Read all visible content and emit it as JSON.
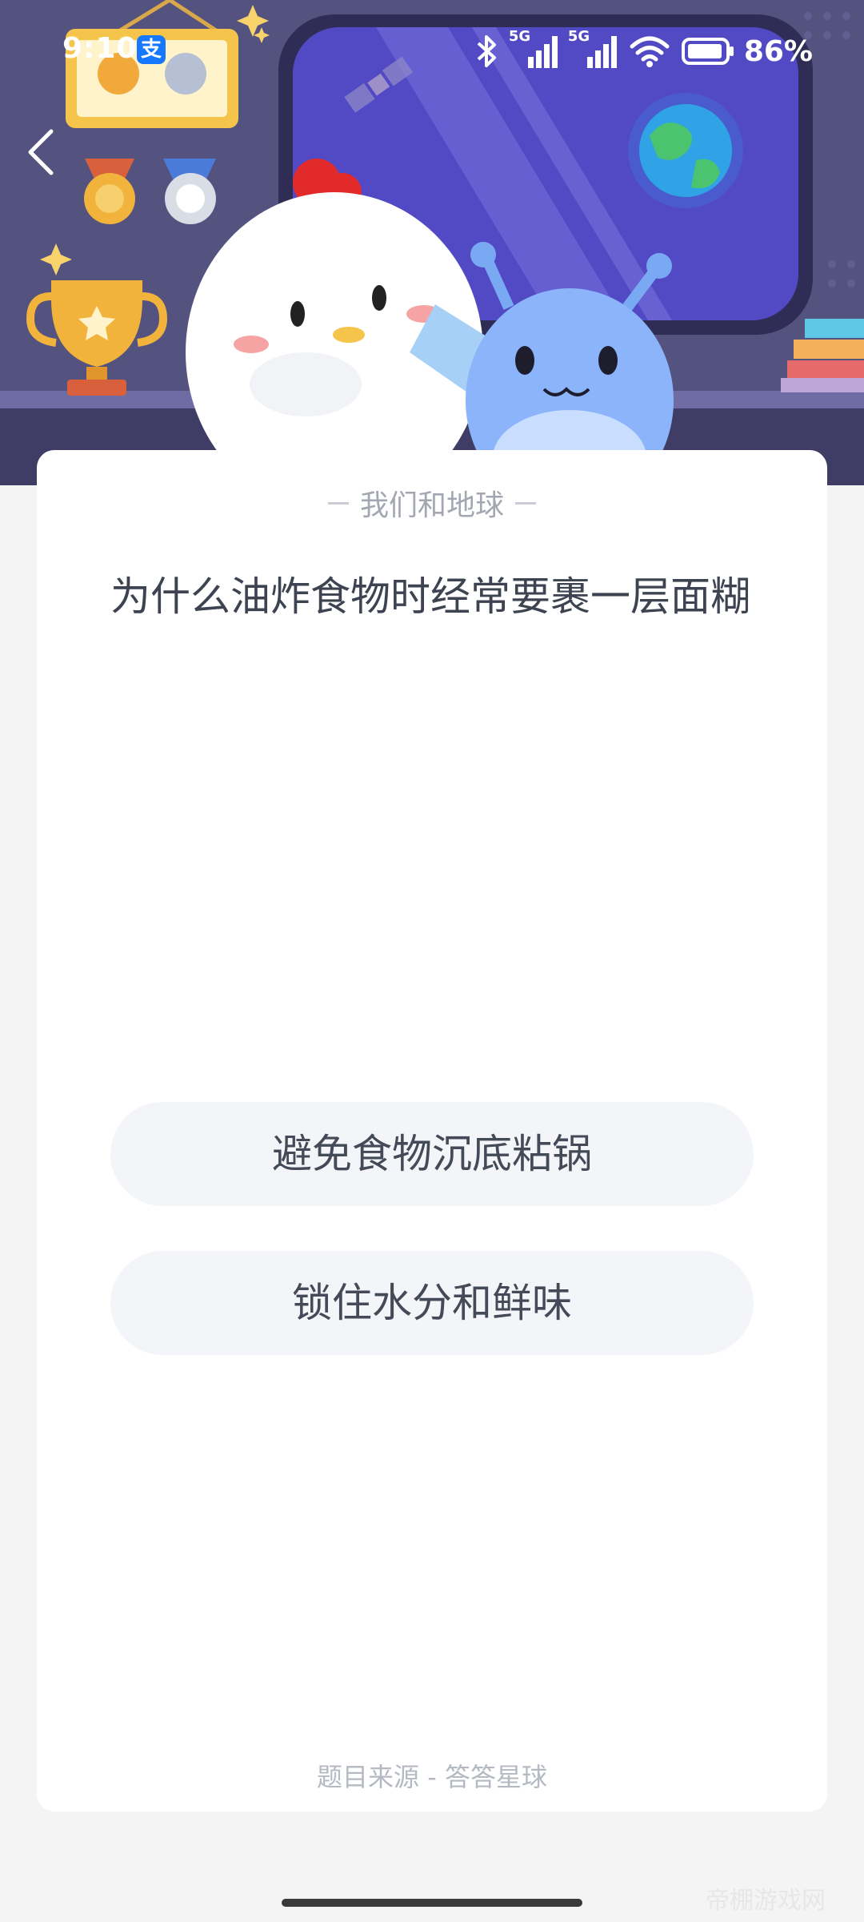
{
  "status_bar": {
    "time": "9:10",
    "alipay_badge": "支",
    "network_1": "5G",
    "network_2": "5G",
    "battery": "86%"
  },
  "header": {
    "back_icon": "chevron-left-icon"
  },
  "card": {
    "category": "我们和地球",
    "question": "为什么油炸食物时经常要裹一层面糊",
    "options": [
      "避免食物沉底粘锅",
      "锁住水分和鲜味"
    ],
    "source": "题目来源 - 答答星球"
  },
  "footer": {
    "watermark": "帝棚游戏网"
  },
  "colors": {
    "hero_bg": "#4f4d79",
    "card_bg": "#ffffff",
    "option_bg": "#f3f5f8",
    "text_dark": "#3d4350",
    "text_muted": "#a3a7b2"
  }
}
